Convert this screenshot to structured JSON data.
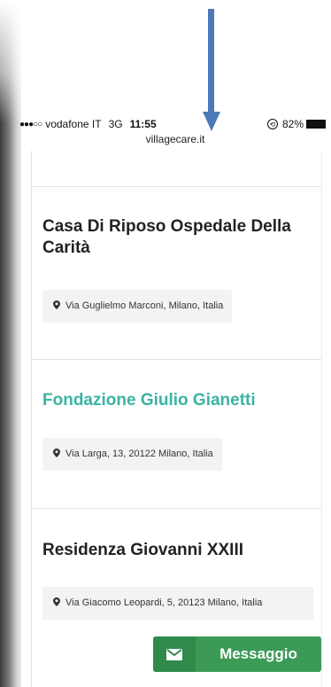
{
  "status_bar": {
    "signal": "●●●○○",
    "carrier": "vodafone IT",
    "network": "3G",
    "time": "11:55",
    "battery": "82%"
  },
  "browser": {
    "url": "villagecare.it"
  },
  "listings": [
    {
      "name": "Casa Di Riposo Ospedale Della Carità",
      "address": "Via Guglielmo Marconi, Milano, Italia"
    },
    {
      "name": "Fondazione Giulio Gianetti",
      "address": "Via Larga, 13, 20122 Milano, Italia"
    },
    {
      "name": "Residenza Giovanni XXIII",
      "address": "Via Giacomo Leopardi, 5, 20123 Milano, Italia"
    }
  ],
  "message_button": {
    "label": "Messaggio"
  },
  "colors": {
    "link": "#3ab4a3",
    "button": "#3c9a57",
    "arrow": "#4c7ab6"
  }
}
